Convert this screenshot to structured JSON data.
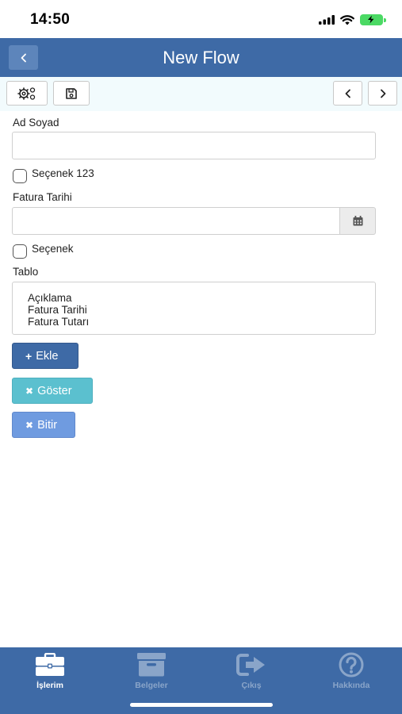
{
  "status_bar": {
    "time": "14:50"
  },
  "nav": {
    "title": "New Flow",
    "back_icon": "chevron-left-icon"
  },
  "toolbar": {
    "left_icons": [
      "settings-gears-icon",
      "save-floppy-icon"
    ],
    "right_icons": [
      "chevron-left-icon",
      "chevron-right-icon"
    ]
  },
  "form": {
    "name_label": "Ad Soyad",
    "name_value": "",
    "option1_label": "Seçenek 123",
    "option1_checked": false,
    "date_label": "Fatura Tarihi",
    "date_value": "",
    "date_icon": "calendar-icon",
    "option2_label": "Seçenek",
    "option2_checked": false,
    "table_label": "Tablo",
    "table_items": [
      "Açıklama",
      "Fatura Tarihi",
      "Fatura Tutarı"
    ]
  },
  "buttons": {
    "add": {
      "icon": "+",
      "label": "Ekle",
      "color": "#3e6aa6"
    },
    "show": {
      "icon": "✖",
      "label": "Göster",
      "color": "#5bc0cf"
    },
    "finish": {
      "icon": "✖",
      "label": "Bitir",
      "color": "#6f9be0"
    }
  },
  "tabs": [
    {
      "label": "İşlerim",
      "icon": "briefcase-icon",
      "active": true,
      "color": "#ffffff"
    },
    {
      "label": "Belgeler",
      "icon": "archive-box-icon",
      "active": false,
      "color": "#8aa5c9"
    },
    {
      "label": "Çıkış",
      "icon": "sign-out-icon",
      "active": false,
      "color": "#8aa5c9"
    },
    {
      "label": "Hakkında",
      "icon": "question-circle-icon",
      "active": false,
      "color": "#8aa5c9"
    }
  ],
  "colors": {
    "primary": "#3e6aa6",
    "toolbar_bg": "#f2fbfd",
    "tab_inactive": "#8aa5c9"
  }
}
